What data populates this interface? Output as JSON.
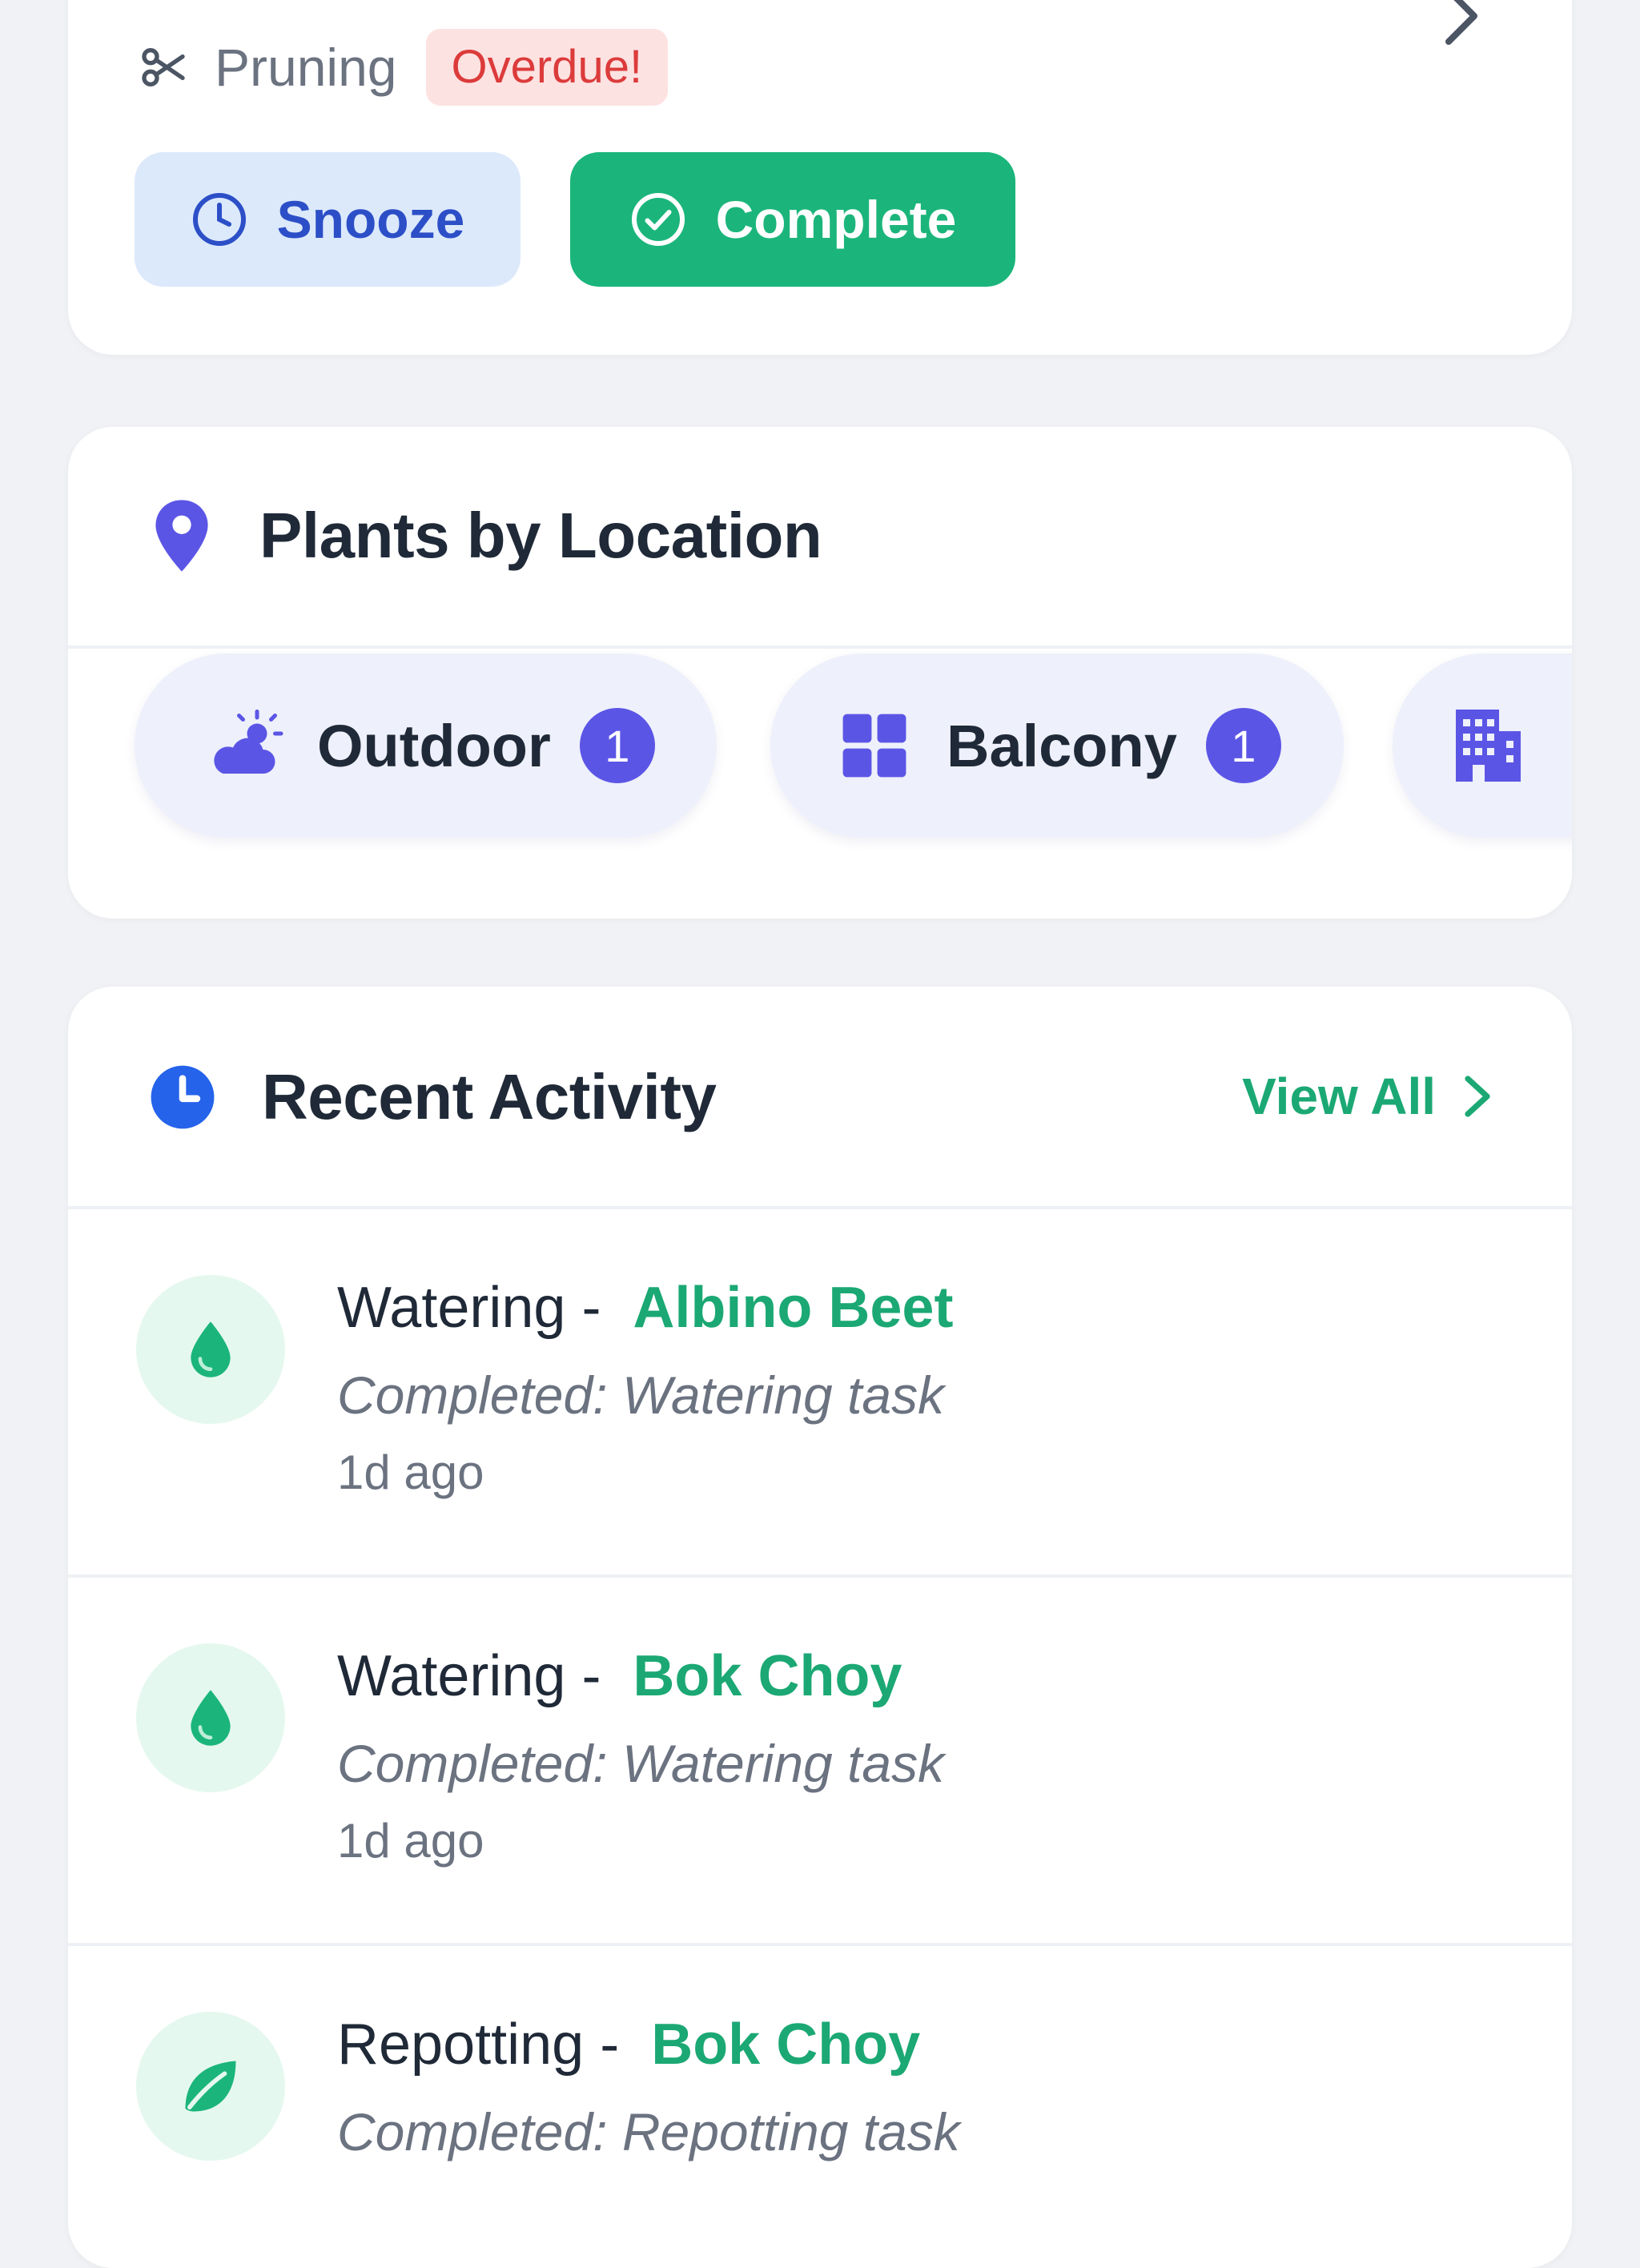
{
  "task_card": {
    "task_type": "Pruning",
    "status_badge": "Overdue!",
    "snooze_label": "Snooze",
    "complete_label": "Complete"
  },
  "location_card": {
    "title": "Plants by Location",
    "chips": [
      {
        "label": "Outdoor",
        "count": "1",
        "icon": "partly-cloudy-icon"
      },
      {
        "label": "Balcony",
        "count": "1",
        "icon": "grid-icon"
      },
      {
        "label": "",
        "count": "",
        "icon": "building-icon"
      }
    ]
  },
  "activity_card": {
    "title": "Recent Activity",
    "view_all_label": "View All",
    "items": [
      {
        "action": "Watering -",
        "plant": "Albino Beet",
        "description": "Completed: Watering task",
        "time": "1d ago",
        "icon": "water-drop-icon"
      },
      {
        "action": "Watering -",
        "plant": "Bok Choy",
        "description": "Completed: Watering task",
        "time": "1d ago",
        "icon": "water-drop-icon"
      },
      {
        "action": "Repotting -",
        "plant": "Bok Choy",
        "description": "Completed: Repotting task",
        "time": "",
        "icon": "leaf-icon"
      }
    ]
  },
  "colors": {
    "accent_green": "#1bb57b",
    "accent_purple": "#5b55e6",
    "overdue_red": "#dc3b3b",
    "snooze_blue": "#2c4fc7",
    "clock_blue": "#2563eb"
  }
}
